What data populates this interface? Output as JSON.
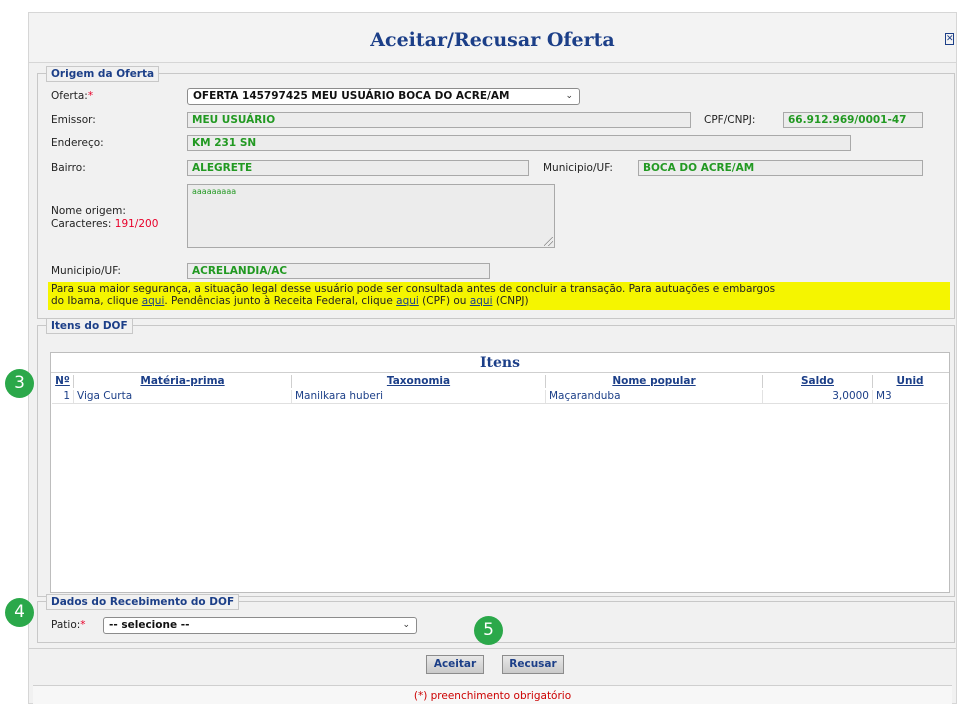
{
  "dialog": {
    "title": "Aceitar/Recusar Oferta",
    "close_glyph": "✕"
  },
  "origem": {
    "legend": "Origem da Oferta",
    "oferta_label": "Oferta:",
    "oferta_required": "*",
    "oferta_value": "OFERTA 145797425 MEU USUÁRIO BOCA DO ACRE/AM",
    "emissor_label": "Emissor:",
    "emissor_value": "MEU USUÁRIO",
    "cpf_label": "CPF/CNPJ:",
    "cpf_value": "66.912.969/0001-47",
    "endereco_label": "Endereço:",
    "endereco_value": "KM 231 SN",
    "bairro_label": "Bairro:",
    "bairro_value": "ALEGRETE",
    "municipio_uf_label": "Municipio/UF:",
    "municipio_uf_value": "BOCA DO ACRE/AM",
    "nome_origem_label": "Nome origem:",
    "caracteres_label": "Caracteres:",
    "caracteres_value": "191/200",
    "nome_origem_value": "aaaaaaaaa",
    "municipio_uf2_label": "Municipio/UF:",
    "municipio_uf2_value": "ACRELANDIA/AC",
    "warning": {
      "text1": "Para sua maior segurança, a situação legal desse usuário pode ser consultada antes de concluir a transação. Para autuações e embargos",
      "text2": "do Ibama, clique ",
      "link1": "aqui",
      "text3": ". Pendências junto à Receita Federal, clique ",
      "link2": "aqui",
      "text4": " (CPF) ou ",
      "link3": "aqui",
      "text5": " (CNPJ)"
    }
  },
  "itens": {
    "legend": "Itens do DOF",
    "grid_title": "Itens",
    "columns": [
      "Nº",
      "Matéria-prima",
      "Taxonomia",
      "Nome popular",
      "Saldo",
      "Unid"
    ],
    "rows": [
      [
        "1",
        "Viga Curta",
        "Manilkara huberi",
        "Maçaranduba",
        "3,0000",
        "M3"
      ]
    ]
  },
  "recebimento": {
    "legend": "Dados do Recebimento do DOF",
    "patio_label": "Patio:",
    "patio_required": "*",
    "patio_value": "-- selecione --"
  },
  "actions": {
    "accept": "Aceitar",
    "reject": "Recusar"
  },
  "footer": {
    "note": "(*) preenchimento obrigatório"
  },
  "markers": {
    "step3": "3",
    "step4": "4",
    "step5": "5"
  },
  "colors": {
    "title_blue": "#1c3f88",
    "value_green": "#229922",
    "required_red": "#e8002a",
    "warning_yellow": "#f5f500",
    "marker_green": "#2ba84a"
  }
}
